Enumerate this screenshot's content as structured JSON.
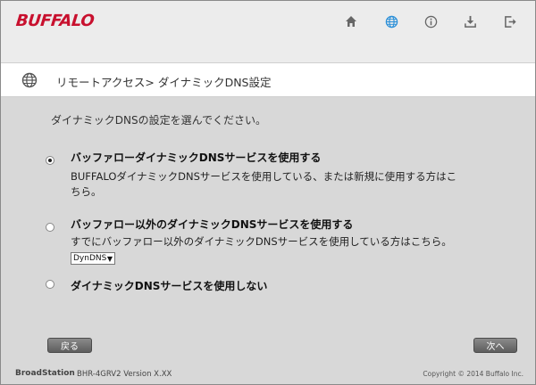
{
  "header": {
    "logo": "BUFFALO",
    "nav_icons": [
      "home-icon",
      "globe-icon",
      "info-icon",
      "download-icon",
      "logout-icon"
    ],
    "active_icon": "globe-icon",
    "colors": {
      "logo": "#c8102e",
      "active_icon": "#2a8fd8",
      "icon": "#666666"
    }
  },
  "breadcrumb": {
    "icon": "globe-icon",
    "text": "リモートアクセス> ダイナミックDNS設定"
  },
  "main": {
    "instruction": "ダイナミックDNSの設定を選んでください。",
    "options": [
      {
        "title": "バッファローダイナミックDNSサービスを使用する",
        "description_line1": "BUFFALOダイナミックDNSサービスを使用している、または新規に使用する方はこ",
        "description_line2": "ちら。",
        "selected": true
      },
      {
        "title": "バッファロー以外のダイナミックDNSサービスを使用する",
        "description_line1": "すでにバッファロー以外のダイナミックDNSサービスを使用している方はこちら。",
        "selected": false,
        "select_value": "DynDNS"
      },
      {
        "title": "ダイナミックDNSサービスを使用しない",
        "selected": false
      }
    ]
  },
  "buttons": {
    "back": "戻る",
    "next": "次へ"
  },
  "footer": {
    "brand": "BroadStation",
    "model": "BHR-4GRV2   Version X.XX",
    "copyright": "Copyright © 2014 Buffalo Inc."
  }
}
